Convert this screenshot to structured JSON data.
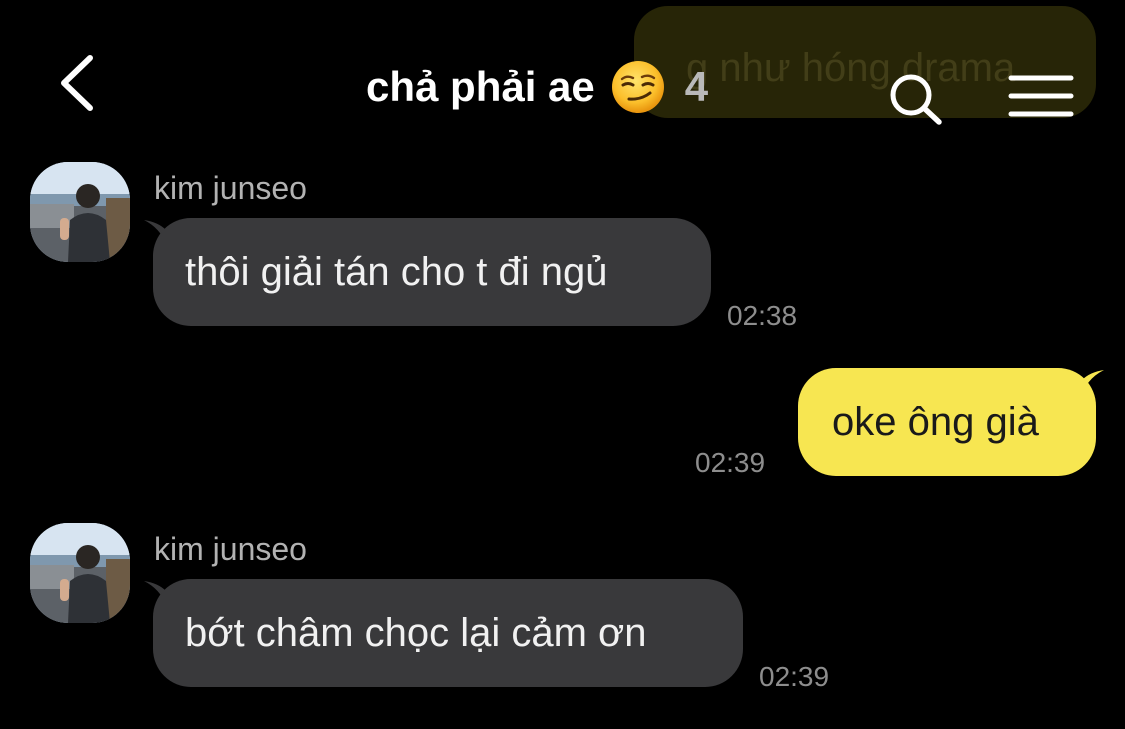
{
  "header": {
    "title": "chả phải ae",
    "title_emoji": "smirking-face-emoji",
    "member_count": "4",
    "background_preview_text": "g như hóng drama",
    "back_icon": "chevron-left-icon",
    "search_icon": "search-icon",
    "menu_icon": "hamburger-menu-icon"
  },
  "messages": [
    {
      "sender": "kim junseo",
      "direction": "incoming",
      "text": "thôi giải tán cho t đi ngủ",
      "time": "02:38"
    },
    {
      "direction": "outgoing",
      "text": "oke ông già",
      "time": "02:39"
    },
    {
      "sender": "kim junseo",
      "direction": "incoming",
      "text": "bớt châm chọc lại cảm ơn",
      "time": "02:39"
    }
  ],
  "colors": {
    "background": "#000000",
    "incoming_bubble": "#39393b",
    "outgoing_bubble": "#f7e651",
    "timestamp": "#8d8d8d",
    "sender_name": "#b2b2b2"
  }
}
